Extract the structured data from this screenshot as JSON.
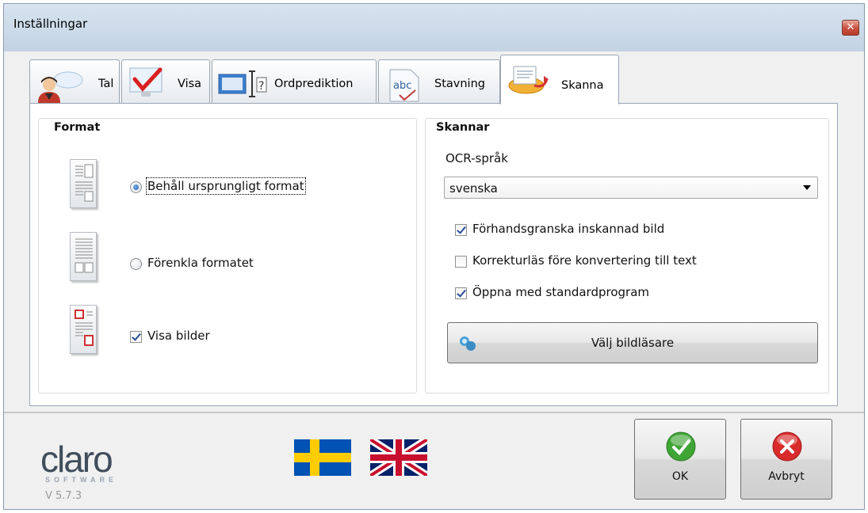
{
  "window": {
    "title": "Inställningar"
  },
  "tabs": [
    {
      "label": "Tal",
      "icon": "speaking-person-icon"
    },
    {
      "label": "Visa",
      "icon": "checkmark-monitor-icon"
    },
    {
      "label": "Ordprediktion",
      "icon": "text-cursor-question-icon"
    },
    {
      "label": "Stavning",
      "icon": "abc-spelling-icon"
    },
    {
      "label": "Skanna",
      "icon": "scanner-icon",
      "active": true
    }
  ],
  "format_group": {
    "title": "Format",
    "options": [
      {
        "label": "Behåll ursprungligt format",
        "type": "radio",
        "checked": true
      },
      {
        "label": "Förenkla formatet",
        "type": "radio",
        "checked": false
      },
      {
        "label": "Visa bilder",
        "type": "checkbox",
        "checked": true
      }
    ]
  },
  "scanner_group": {
    "title": "Skannar",
    "ocr_label": "OCR-språk",
    "ocr_value": "svenska",
    "checkboxes": [
      {
        "label": "Förhandsgranska inskannad bild",
        "checked": true
      },
      {
        "label": "Korrekturläs före konvertering till text",
        "checked": false
      },
      {
        "label": "Öppna med standardprogram",
        "checked": true
      }
    ],
    "choose_reader_button": "Välj bildläsare"
  },
  "footer": {
    "logo_text": "claro",
    "logo_sub": "SOFTWARE",
    "version": "V 5.7.3",
    "ok_label": "OK",
    "cancel_label": "Avbryt"
  },
  "colors": {
    "accent_red": "#c8503f",
    "ok_green": "#3fa535",
    "cancel_red": "#d92b2b"
  }
}
